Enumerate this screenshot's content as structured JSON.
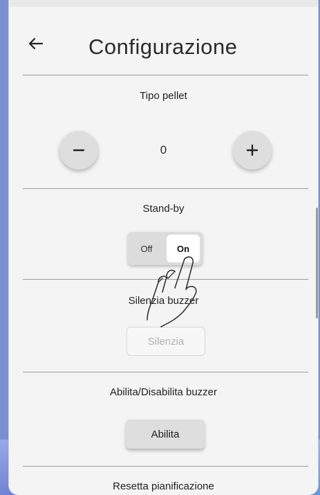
{
  "header": {
    "title": "Configurazione",
    "back_icon": "arrow-left-icon"
  },
  "pellet": {
    "label": "Tipo pellet",
    "value": "0",
    "minus_icon": "minus-icon",
    "plus_icon": "plus-icon"
  },
  "standby": {
    "label": "Stand-by",
    "off_label": "Off",
    "on_label": "On",
    "selected": "On"
  },
  "buzzer_silence": {
    "label": "Silenzia buzzer",
    "button_label": "Silenzia"
  },
  "buzzer_toggle": {
    "label": "Abilita/Disabilita buzzer",
    "button_label": "Abilita"
  },
  "schedule_reset": {
    "label": "Resetta pianificazione"
  },
  "gesture": {
    "icon": "hand-pointer-icon"
  }
}
